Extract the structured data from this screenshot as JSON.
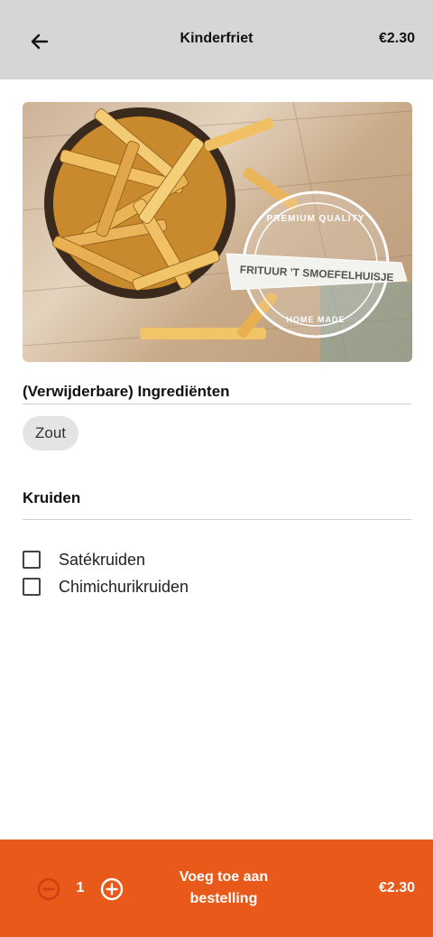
{
  "header": {
    "back_icon": "arrow-left-icon",
    "title": "Kinderfriet",
    "price": "€2.30"
  },
  "hero": {
    "alt": "Friet in een kom met het logo van Frituur 't Smoefelhuisje",
    "logo": {
      "top_text": "PREMIUM QUALITY",
      "banner_text": "FRITUUR 'T SMOEFELHUISJE",
      "bottom_text": "HOME MADE"
    }
  },
  "ingredients": {
    "title": "(Verwijderbare) Ingrediënten",
    "items": [
      {
        "label": "Zout"
      }
    ]
  },
  "herbs": {
    "title": "Kruiden",
    "options": [
      {
        "label": "Satékruiden",
        "checked": false
      },
      {
        "label": "Chimichurikruiden",
        "checked": false
      }
    ]
  },
  "footer": {
    "minus_icon": "minus-circle-icon",
    "plus_icon": "plus-circle-icon",
    "quantity": "1",
    "add_label_line1": "Voeg toe aan",
    "add_label_line2": "bestelling",
    "price": "€2.30"
  },
  "colors": {
    "header_bg": "#d6d6d6",
    "accent": "#e8591a",
    "chip_bg": "#e4e4e4"
  }
}
